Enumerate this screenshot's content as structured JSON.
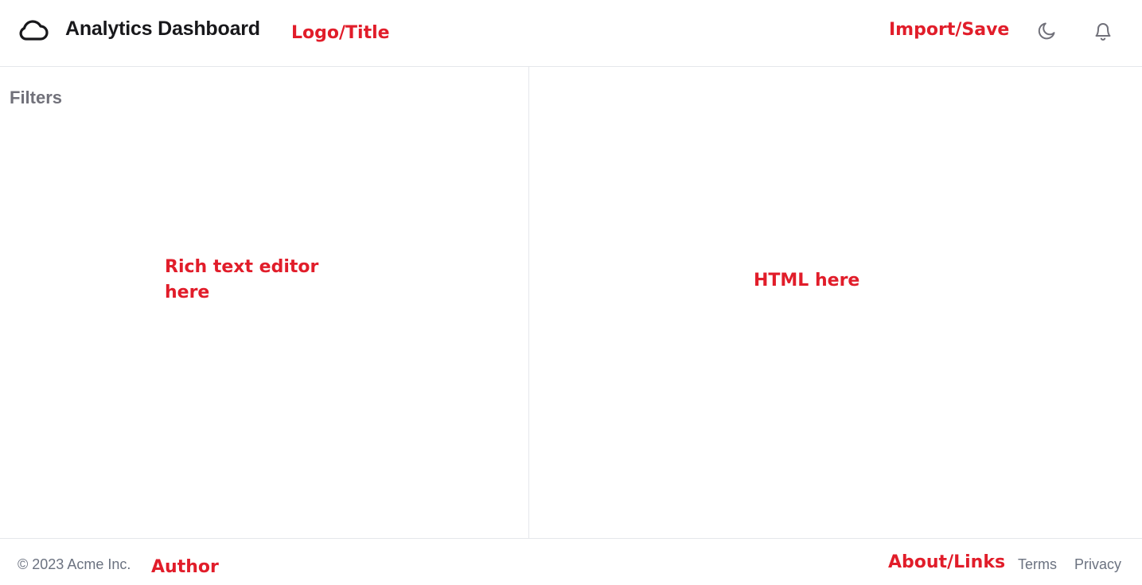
{
  "header": {
    "logo_icon": "cloud-icon",
    "title": "Analytics Dashboard",
    "annotation_title": "Logo/Title",
    "annotation_actions": "Import/Save",
    "theme_icon": "moon-icon",
    "notification_icon": "bell-icon"
  },
  "left_panel": {
    "heading": "Filters",
    "annotation_line1": "Rich text editor",
    "annotation_line2": "here"
  },
  "right_panel": {
    "annotation": "HTML here"
  },
  "footer": {
    "copyright": "© 2023 Acme Inc.",
    "annotation_author": "Author",
    "annotation_links": "About/Links",
    "links": [
      {
        "label": "Terms"
      },
      {
        "label": "Privacy"
      }
    ]
  },
  "colors": {
    "annotation": "#e11d2a",
    "border": "#e5e7eb",
    "muted_text": "#6b7280",
    "title_text": "#18181b"
  }
}
